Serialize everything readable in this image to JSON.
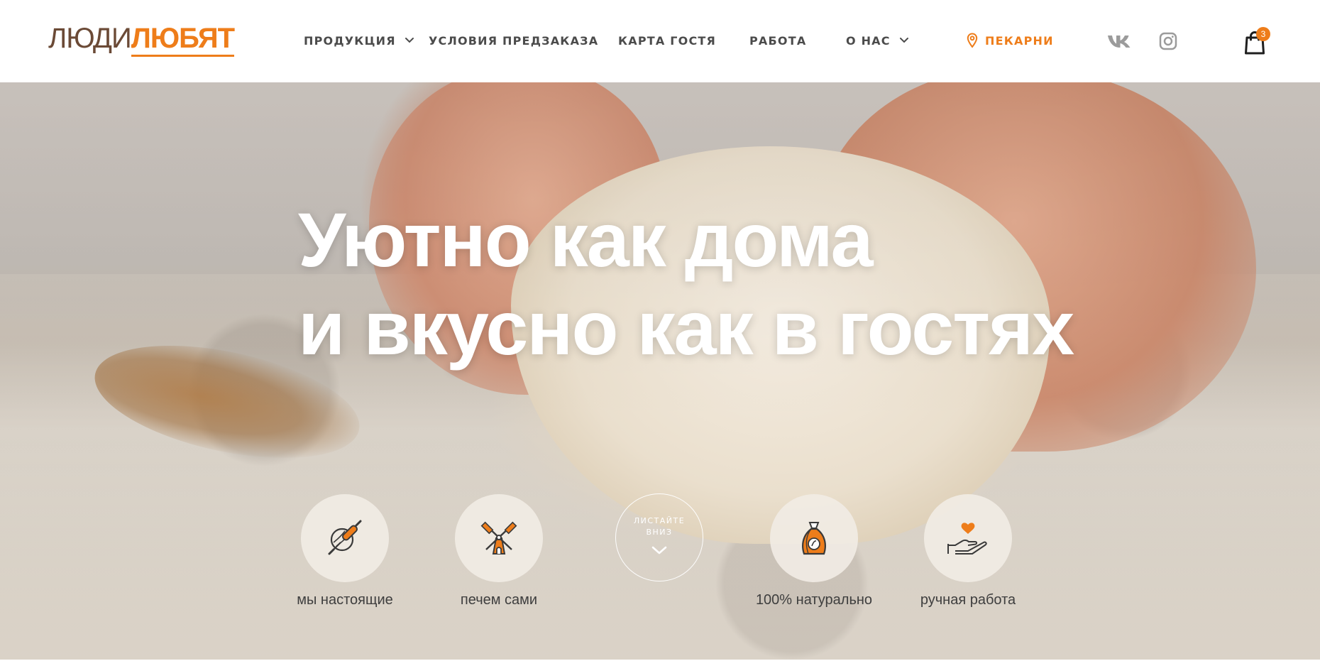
{
  "logo": {
    "part1": "ЛЮДИ",
    "part2": "ЛЮБЯТ"
  },
  "nav": {
    "products": "ПРОДУКЦИЯ",
    "preorder": "УСЛОВИЯ ПРЕДЗАКАЗА",
    "guest_card": "КАРТА ГОСТЯ",
    "jobs": "РАБОТА",
    "about": "О НАС",
    "bakeries": "ПЕКАРНИ"
  },
  "social": {
    "vk": "vk-icon",
    "instagram": "instagram-icon"
  },
  "cart": {
    "count": "3"
  },
  "hero": {
    "title_line1": "Уютно как дома",
    "title_line2": "и вкусно как в гостях",
    "scroll_label": "ЛИСТАЙТЕ ВНИЗ"
  },
  "features": [
    {
      "label": "мы настоящие",
      "icon": "rolling-pin-icon"
    },
    {
      "label": "печем сами",
      "icon": "windmill-icon"
    },
    {
      "label": "100% натурально",
      "icon": "flour-bag-icon"
    },
    {
      "label": "ручная работа",
      "icon": "heart-hand-icon"
    }
  ],
  "colors": {
    "accent": "#ee7d1a",
    "brown": "#6b4a36",
    "nav_text": "#4b4b4b"
  }
}
